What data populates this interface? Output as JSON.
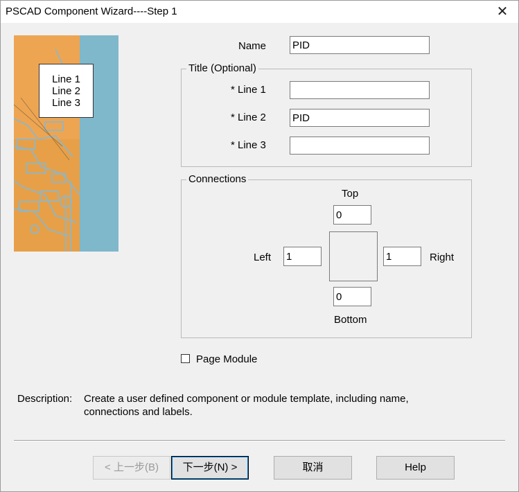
{
  "window": {
    "title": "PSCAD Component Wizard----Step 1",
    "close_glyph": "✕"
  },
  "preview": {
    "lines": [
      "Line 1",
      "Line 2",
      "Line 3"
    ]
  },
  "name": {
    "label": "Name",
    "value": "PID"
  },
  "title_group": {
    "legend": "Title (Optional)",
    "fields": [
      {
        "label": "* Line 1",
        "value": ""
      },
      {
        "label": "* Line 2",
        "value": "PID"
      },
      {
        "label": "* Line 3",
        "value": ""
      }
    ]
  },
  "connections": {
    "legend": "Connections",
    "top": {
      "label": "Top",
      "value": "0"
    },
    "left": {
      "label": "Left",
      "value": "1"
    },
    "right": {
      "label": "Right",
      "value": "1"
    },
    "bottom": {
      "label": "Bottom",
      "value": "0"
    }
  },
  "page_module": {
    "label": "Page Module",
    "checked": false
  },
  "description": {
    "label": "Description:",
    "line1": "Create a user defined component or module template, including name,",
    "line2": "connections and labels."
  },
  "buttons": {
    "back": "< 上一步(B)",
    "next": "下一步(N) >",
    "cancel": "取消",
    "help": "Help"
  },
  "colors": {
    "art_orange": "#e7a048",
    "art_blue": "#7fb7cb",
    "focus_blue": "#0078d7"
  }
}
